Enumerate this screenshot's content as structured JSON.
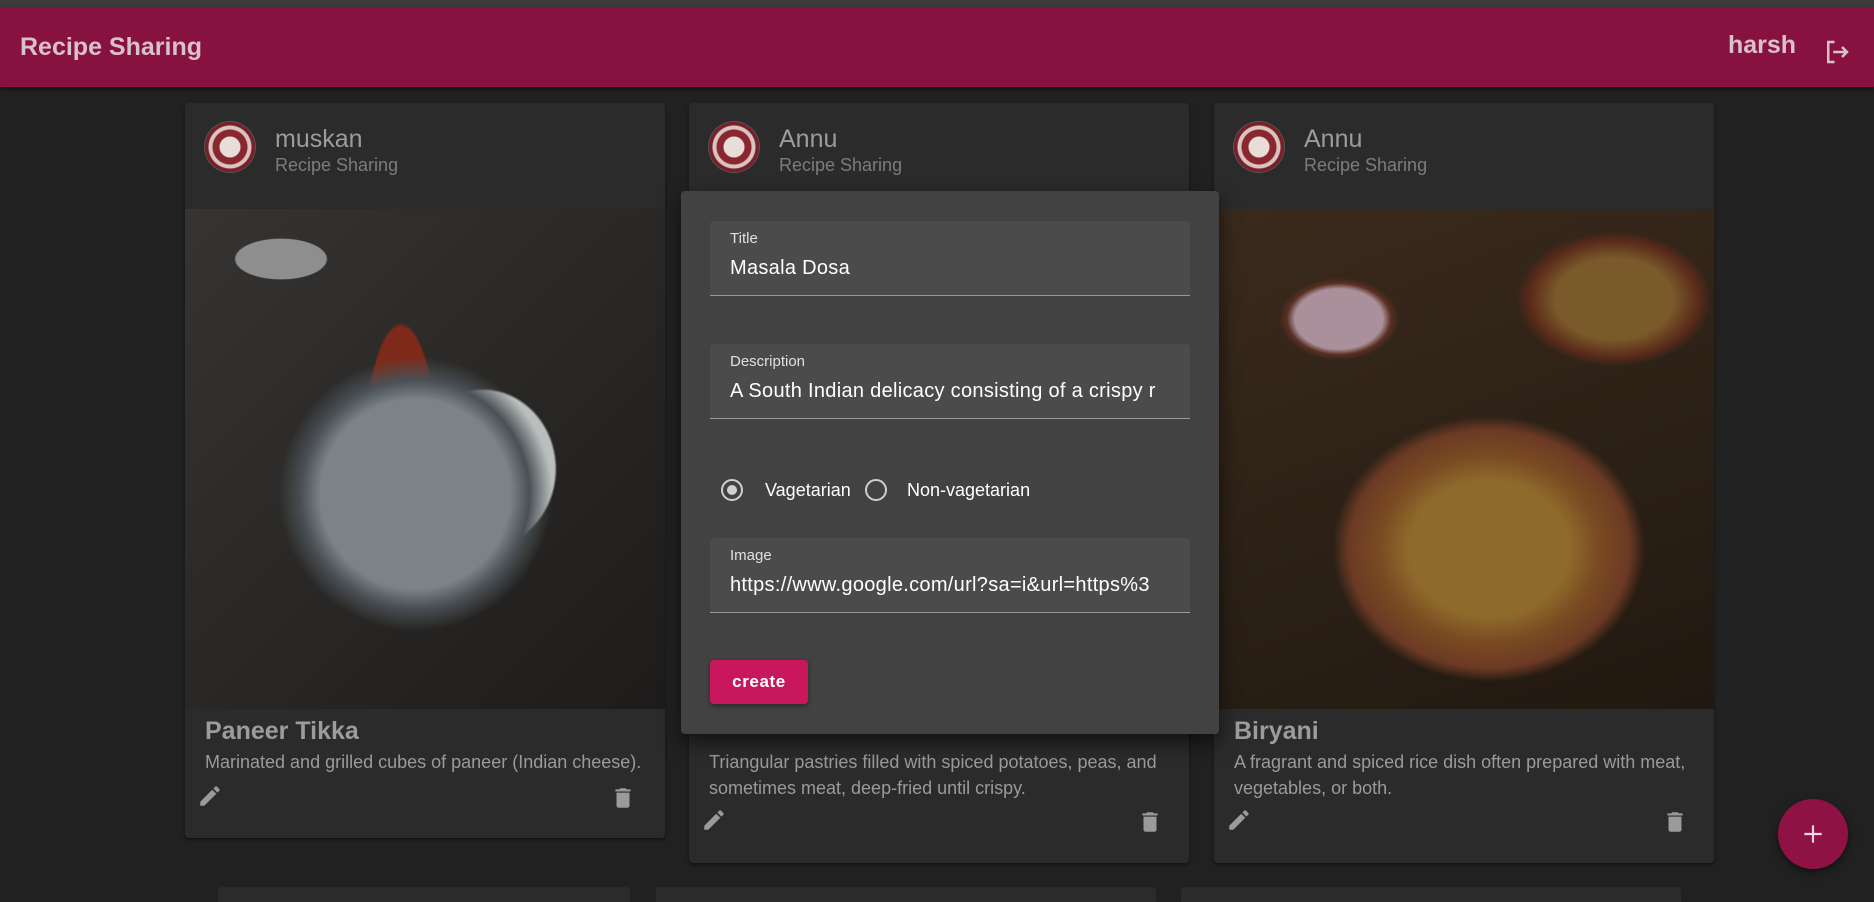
{
  "appbar": {
    "title": "Recipe Sharing",
    "username": "harsh",
    "logout_icon": "logout-icon",
    "color": "#88123f"
  },
  "cards": [
    {
      "author": "muskan",
      "subheader": "Recipe Sharing",
      "title": "Paneer Tikka",
      "description": "Marinated and grilled cubes of paneer (Indian cheese).",
      "image_alt": "paneer-tikka-photo"
    },
    {
      "author": "Annu",
      "subheader": "Recipe Sharing",
      "title": "",
      "description": "Triangular pastries filled with spiced potatoes, peas, and sometimes meat, deep-fried until crispy.",
      "image_alt": "samosa-photo"
    },
    {
      "author": "Annu",
      "subheader": "Recipe Sharing",
      "title": "Biryani",
      "description": "A fragrant and spiced rice dish often prepared with meat, vegetables, or both.",
      "image_alt": "biryani-photo"
    }
  ],
  "form": {
    "title_label": "Title",
    "title_value": "Masala Dosa",
    "description_label": "Description",
    "description_value": "A South Indian delicacy consisting of a crispy r",
    "radio_veg_label": "Vagetarian",
    "radio_nonveg_label": "Non-vagetarian",
    "selected_option": "Vagetarian",
    "image_label": "Image",
    "image_value": "https://www.google.com/url?sa=i&url=https%3",
    "create_label": "create",
    "accent": "#c8175d"
  },
  "fab": {
    "icon": "plus-icon",
    "color": "#8e1244"
  }
}
